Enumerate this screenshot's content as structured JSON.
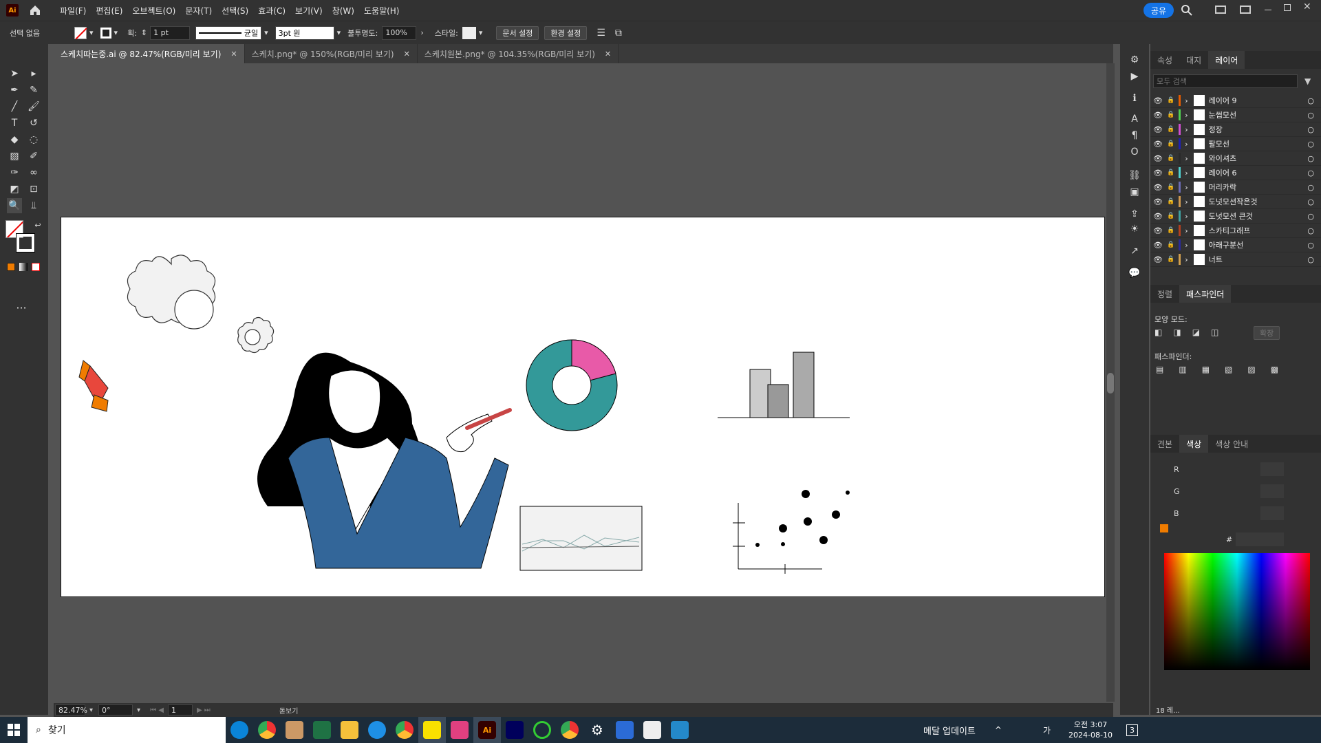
{
  "menubar": {
    "logo": "Ai",
    "items": [
      "파일(F)",
      "편집(E)",
      "오브젝트(O)",
      "문자(T)",
      "선택(S)",
      "효과(C)",
      "보기(V)",
      "창(W)",
      "도움말(H)"
    ],
    "share": "공유"
  },
  "control": {
    "selection": "선택 없음",
    "stroke_label": "획:",
    "stroke_weight": "1 pt",
    "profile": "균일",
    "brush": "3pt 원",
    "opacity_label": "불투명도:",
    "opacity": "100%",
    "style_label": "스타일:",
    "doc_setup": "문서 설정",
    "prefs": "환경 설정"
  },
  "tabs": [
    {
      "label": "스케치따는중.ai @ 82.47%(RGB/미리 보기)"
    },
    {
      "label": "스케치.png* @ 150%(RGB/미리 보기)"
    },
    {
      "label": "스케치원본.png* @ 104.35%(RGB/미리 보기)"
    }
  ],
  "panel_top": {
    "tabs": [
      "속성",
      "대지",
      "레이어"
    ],
    "search_placeholder": "모두 검색"
  },
  "layers": [
    {
      "name": "레이어 9",
      "color": "#e65c00"
    },
    {
      "name": "눈썹모선",
      "color": "#4fd14f"
    },
    {
      "name": "정장",
      "color": "#d14fd1"
    },
    {
      "name": "팔모선",
      "color": "#1f1fb3"
    },
    {
      "name": "와이셔츠",
      "color": "#2a2a2a"
    },
    {
      "name": "레이어 6",
      "color": "#4fd1d1"
    },
    {
      "name": "머리카락",
      "color": "#6b6bb3"
    },
    {
      "name": "도넛모션작은것",
      "color": "#d19a4f"
    },
    {
      "name": "도넛모션 큰것",
      "color": "#3fa0a0"
    },
    {
      "name": "스카티그래프",
      "color": "#b3401f"
    },
    {
      "name": "아래구분선",
      "color": "#2a2a9a"
    },
    {
      "name": "너트",
      "color": "#d1a04f"
    }
  ],
  "layer_count": "18 레...",
  "pathfinder": {
    "tabs": [
      "정렬",
      "패스파인더"
    ],
    "shape_modes": "모양 모드:",
    "expand": "확장",
    "pathfinders": "패스파인더:"
  },
  "color_panel": {
    "tabs": [
      "견본",
      "색상",
      "색상 안내"
    ],
    "r": "R",
    "g": "G",
    "b": "B",
    "hash": "#"
  },
  "status": {
    "zoom": "82.47%",
    "rotate": "0°",
    "artboard": "1",
    "mode": "돋보기"
  },
  "taskbar": {
    "search": "찾기",
    "notice": "메달 업데이트",
    "time": "오전 3:07",
    "date": "2024-08-10",
    "lang": "가",
    "notif": "3"
  },
  "chart_small": {
    "type": "bar",
    "values": [
      70,
      48,
      95
    ]
  },
  "icons": [
    "home-icon",
    "search-icon",
    "eye-icon",
    "lock-icon",
    "chevron-right-icon",
    "filter-icon",
    "close-icon",
    "windows-icon"
  ]
}
